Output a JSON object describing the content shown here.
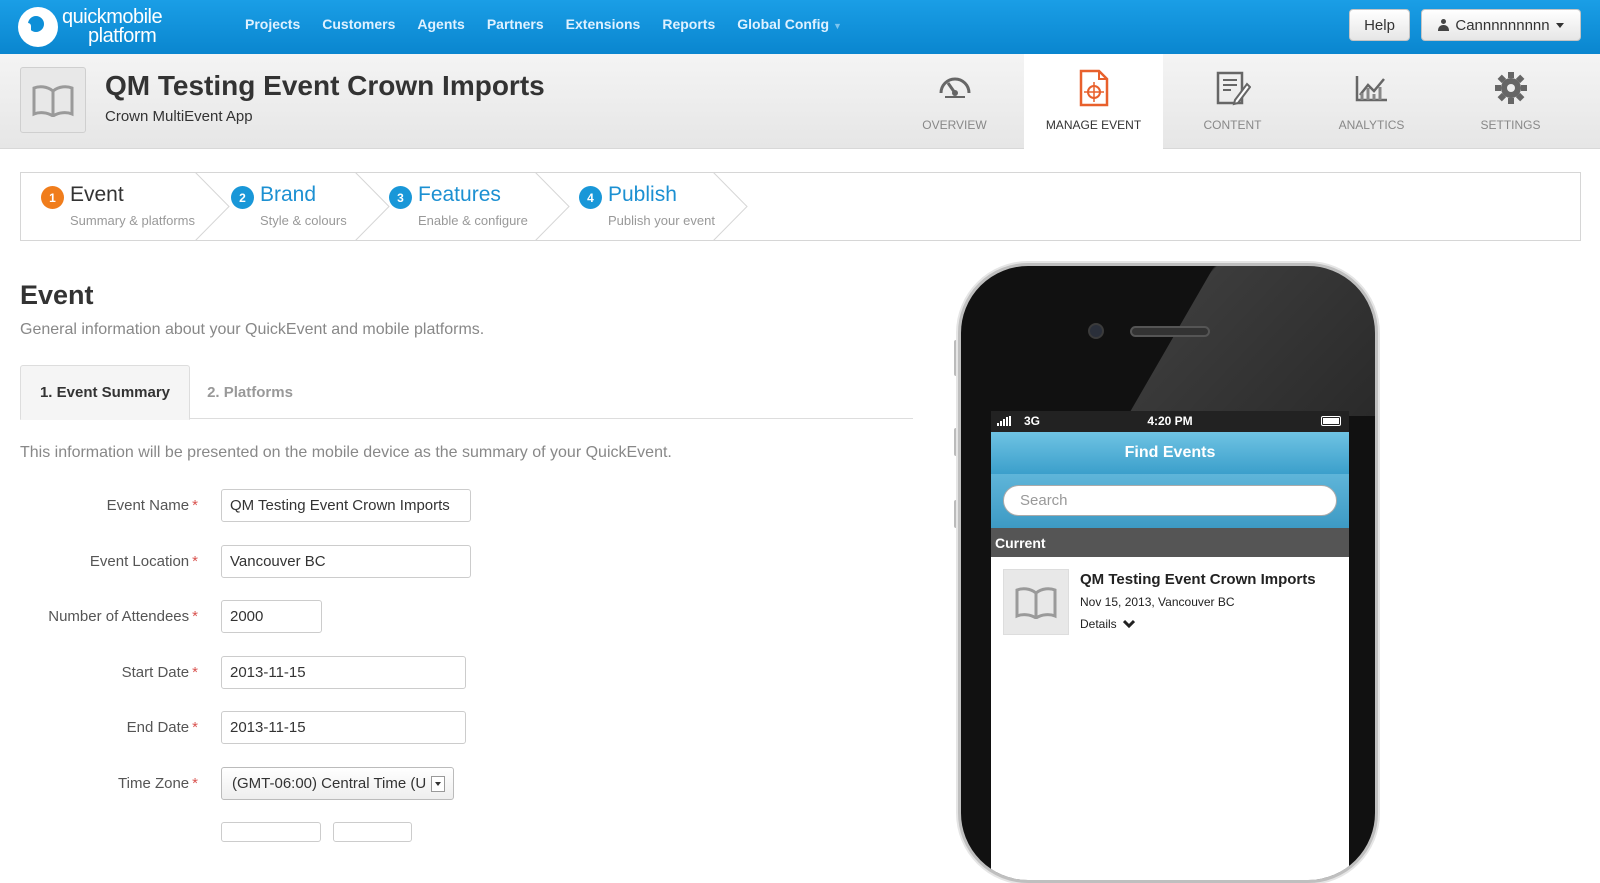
{
  "brand": {
    "line1": "quickmobile",
    "line2": "platform"
  },
  "nav": {
    "items": [
      "Projects",
      "Customers",
      "Agents",
      "Partners",
      "Extensions",
      "Reports",
      "Global Config"
    ]
  },
  "topbar": {
    "help_label": "Help",
    "user_label": "Cannnnnnnnn"
  },
  "app": {
    "title": "QM Testing Event Crown Imports",
    "subtitle": "Crown MultiEvent App"
  },
  "header_tabs": [
    {
      "label": "OVERVIEW",
      "icon": "gauge-icon",
      "active": false
    },
    {
      "label": "MANAGE EVENT",
      "icon": "event-document-icon",
      "active": true
    },
    {
      "label": "CONTENT",
      "icon": "edit-document-icon",
      "active": false
    },
    {
      "label": "ANALYTICS",
      "icon": "chart-icon",
      "active": false
    },
    {
      "label": "SETTINGS",
      "icon": "gear-icon",
      "active": false
    }
  ],
  "wizard": [
    {
      "num": "1",
      "title": "Event",
      "sub": "Summary & platforms",
      "current": true
    },
    {
      "num": "2",
      "title": "Brand",
      "sub": "Style & colours",
      "current": false
    },
    {
      "num": "3",
      "title": "Features",
      "sub": "Enable & configure",
      "current": false
    },
    {
      "num": "4",
      "title": "Publish",
      "sub": "Publish your event",
      "current": false
    }
  ],
  "section": {
    "title": "Event",
    "desc": "General information about your QuickEvent and mobile platforms.",
    "info": "This information will be presented on the mobile device as the summary of your QuickEvent."
  },
  "form_tabs": [
    {
      "label": "1. Event Summary",
      "active": true
    },
    {
      "label": "2. Platforms",
      "active": false
    }
  ],
  "form": {
    "required_mark": "*",
    "event_name": {
      "label": "Event Name",
      "value": "QM Testing Event Crown Imports"
    },
    "event_location": {
      "label": "Event Location",
      "value": "Vancouver BC"
    },
    "attendees": {
      "label": "Number of Attendees",
      "value": "2000"
    },
    "start_date": {
      "label": "Start Date",
      "value": "2013-11-15"
    },
    "end_date": {
      "label": "End Date",
      "value": "2013-11-15"
    },
    "time_zone": {
      "label": "Time Zone",
      "value": "(GMT-06:00) Central Time (U"
    }
  },
  "phone": {
    "status": {
      "network": "3G",
      "time": "4:20 PM"
    },
    "header": "Find Events",
    "search_placeholder": "Search",
    "group_label": "Current",
    "event": {
      "title": "QM Testing Event Crown Imports",
      "meta": "Nov 15, 2013, Vancouver BC",
      "details_label": "Details"
    }
  },
  "colors": {
    "topbar": "#0d8fd8",
    "accent_blue": "#1c90d2",
    "step_current": "#f07d1c",
    "required": "#d9534f"
  }
}
